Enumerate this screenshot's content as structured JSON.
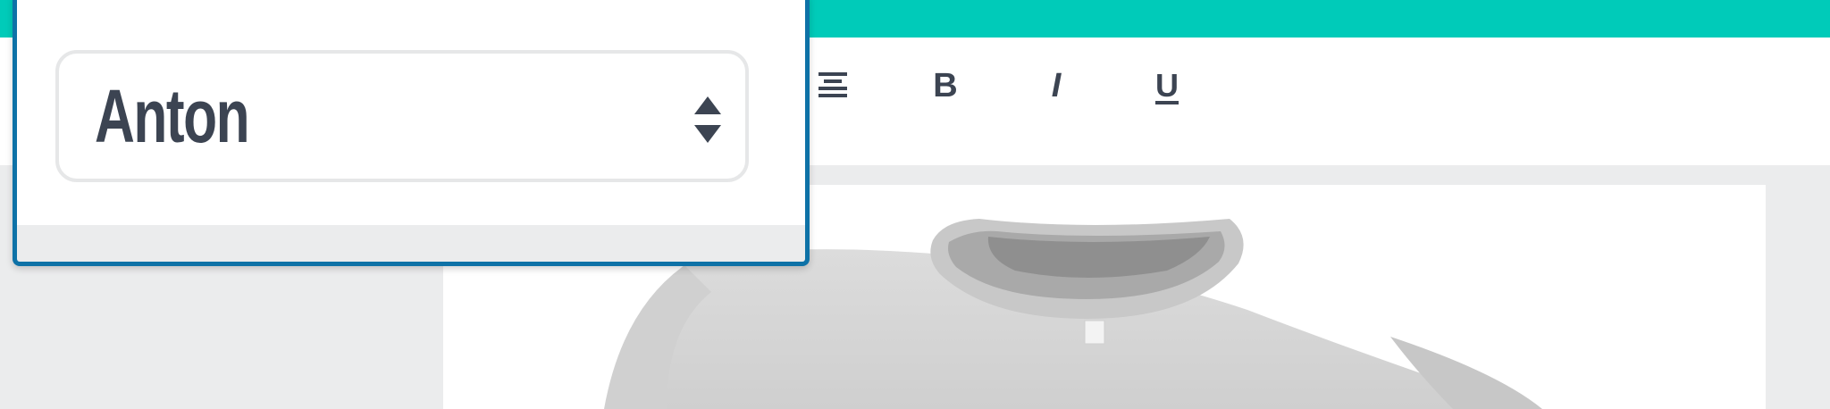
{
  "font_selector": {
    "selected_font": "Anton",
    "stepper_icon": "up-down-chevron-icon"
  },
  "toolbar": {
    "align_icon": "align-center-icon",
    "bold_label": "B",
    "italic_label": "I",
    "underline_label": "U"
  },
  "colors": {
    "accent": "#00cbb9",
    "popover_border": "#0e72a7",
    "text": "#3c4452",
    "background": "#ebeced"
  },
  "canvas": {
    "product": "t-shirt-image"
  }
}
